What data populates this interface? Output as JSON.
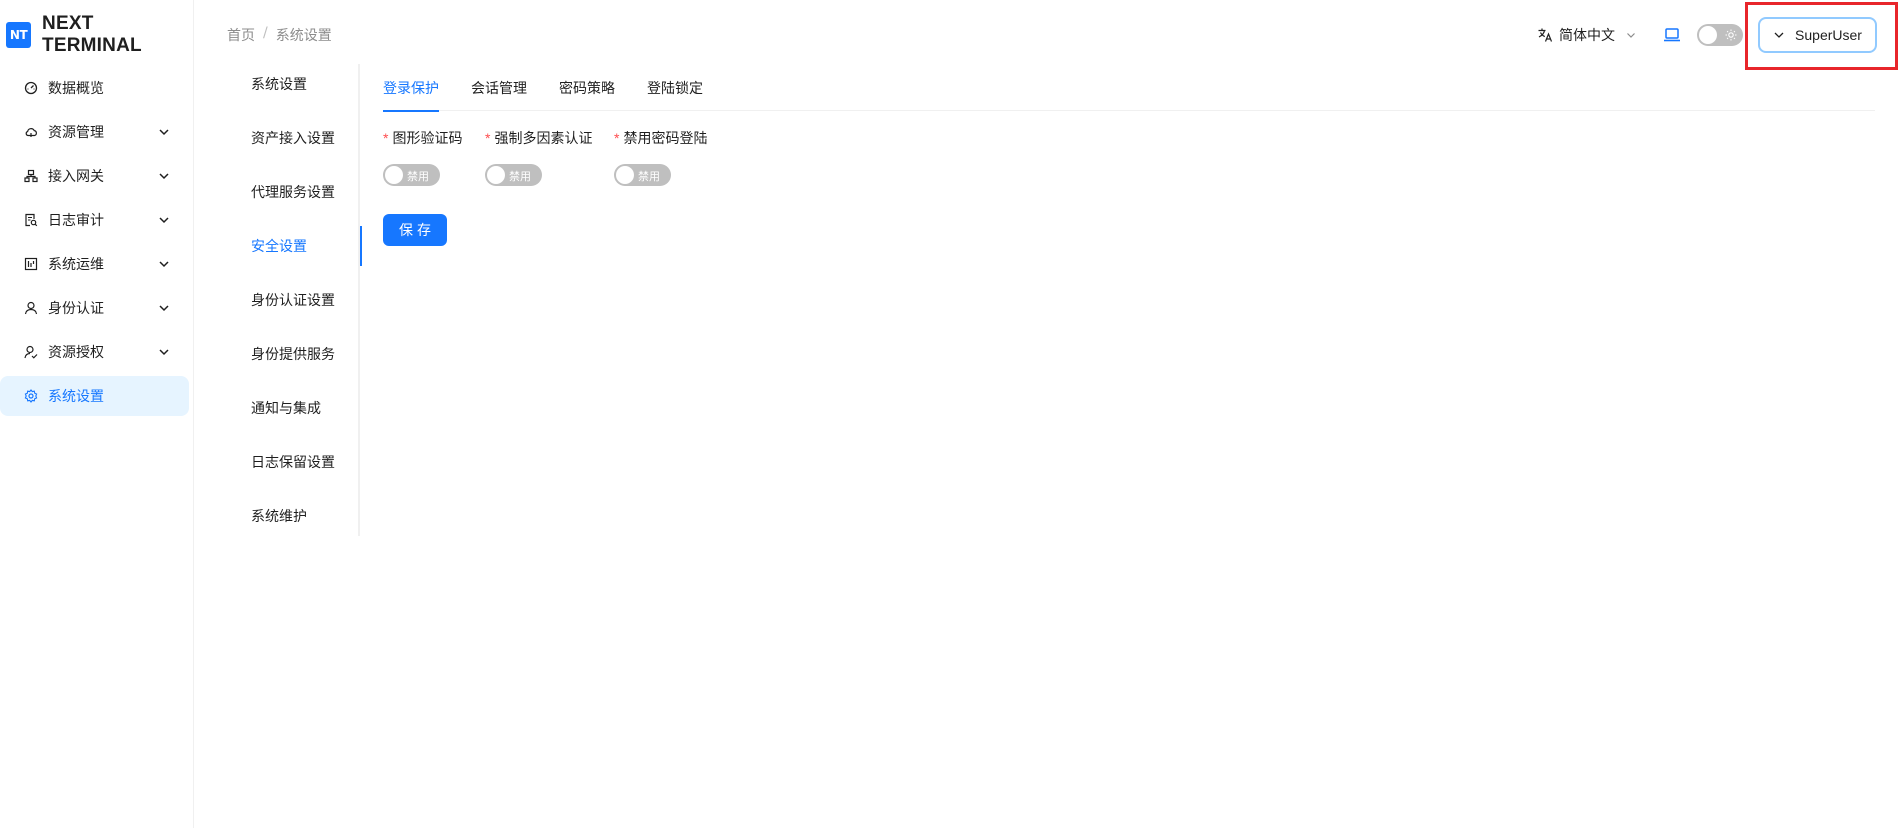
{
  "brand": {
    "logo": "NT",
    "name": "NEXT TERMINAL"
  },
  "sidebar": {
    "items": [
      {
        "label": "数据概览",
        "icon": "dashboard-icon",
        "expandable": false
      },
      {
        "label": "资源管理",
        "icon": "cloud-icon",
        "expandable": true
      },
      {
        "label": "接入网关",
        "icon": "network-icon",
        "expandable": true
      },
      {
        "label": "日志审计",
        "icon": "audit-icon",
        "expandable": true
      },
      {
        "label": "系统运维",
        "icon": "ops-icon",
        "expandable": true
      },
      {
        "label": "身份认证",
        "icon": "user-icon",
        "expandable": true
      },
      {
        "label": "资源授权",
        "icon": "user-check-icon",
        "expandable": true
      },
      {
        "label": "系统设置",
        "icon": "gear-icon",
        "expandable": false,
        "active": true
      }
    ]
  },
  "header": {
    "breadcrumb": {
      "home": "首页",
      "separator": "/",
      "current": "系统设置"
    },
    "language": "简体中文",
    "user": "SuperUser"
  },
  "submenu": {
    "items": [
      "系统设置",
      "资产接入设置",
      "代理服务设置",
      "安全设置",
      "身份认证设置",
      "身份提供服务",
      "通知与集成",
      "日志保留设置",
      "系统维护"
    ],
    "active_index": 3
  },
  "tabs": {
    "items": [
      "登录保护",
      "会话管理",
      "密码策略",
      "登陆锁定"
    ],
    "active_index": 0
  },
  "form": {
    "required_mark": "*",
    "fields": [
      {
        "label": "图形验证码",
        "switch_text": "禁用",
        "enabled": false
      },
      {
        "label": "强制多因素认证",
        "switch_text": "禁用",
        "enabled": false
      },
      {
        "label": "禁用密码登陆",
        "switch_text": "禁用",
        "enabled": false
      }
    ],
    "save_label": "保存"
  },
  "colors": {
    "primary": "#1677ff",
    "active_bg": "#e6f4ff",
    "required": "#ff4d4f",
    "switch_off": "#bfbfbf",
    "highlight": "#e8262b"
  }
}
